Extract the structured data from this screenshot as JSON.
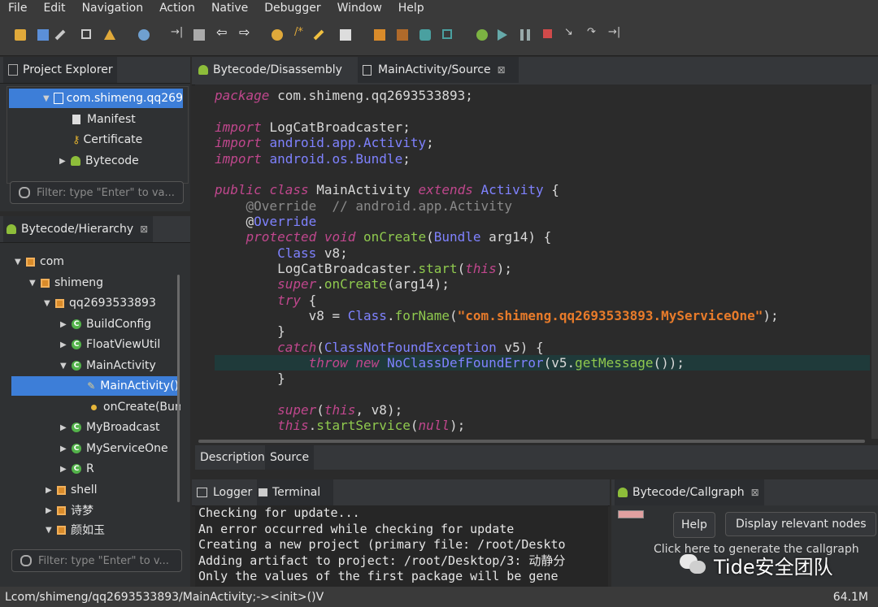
{
  "menu": [
    "File",
    "Edit",
    "Navigation",
    "Action",
    "Native",
    "Debugger",
    "Window",
    "Help"
  ],
  "project_explorer": {
    "tab": "Project Explorer",
    "items": [
      {
        "label": "com.shimeng.qq269",
        "kind": "project",
        "selected": true
      },
      {
        "label": "Manifest",
        "kind": "manifest"
      },
      {
        "label": "Certificate",
        "kind": "key"
      },
      {
        "label": "Bytecode",
        "kind": "droid"
      }
    ],
    "filter_placeholder": "Filter: type \"Enter\" to va..."
  },
  "hierarchy": {
    "tab": "Bytecode/Hierarchy",
    "items": [
      {
        "label": "com",
        "kind": "pkg",
        "expanded": true
      },
      {
        "label": "shimeng",
        "kind": "pkg",
        "expanded": true
      },
      {
        "label": "qq2693533893",
        "kind": "pkg",
        "expanded": true
      },
      {
        "label": "BuildConfig",
        "kind": "class"
      },
      {
        "label": "FloatViewUtil",
        "kind": "class"
      },
      {
        "label": "MainActivity",
        "kind": "class",
        "expanded": true
      },
      {
        "label": "MainActivity()",
        "kind": "method",
        "selected": true
      },
      {
        "label": "onCreate(Bun",
        "kind": "method"
      },
      {
        "label": "MyBroadcast",
        "kind": "class"
      },
      {
        "label": "MyServiceOne",
        "kind": "class"
      },
      {
        "label": "R",
        "kind": "class"
      },
      {
        "label": "shell",
        "kind": "pkg"
      },
      {
        "label": "诗梦",
        "kind": "pkg"
      },
      {
        "label": "颜如玉",
        "kind": "pkg",
        "expanded": true
      }
    ],
    "filter_placeholder": "Filter: type \"Enter\" to v..."
  },
  "editor": {
    "tabs": [
      "Bytecode/Disassembly",
      "MainActivity/Source"
    ],
    "bottom_tabs": [
      "Description",
      "Source"
    ]
  },
  "code_lines": [
    "package com.shimeng.qq2693533893;",
    "",
    "import LogCatBroadcaster;",
    "import android.app.Activity;",
    "import android.os.Bundle;",
    "",
    "public class MainActivity extends Activity {",
    "    @Override  // android.app.Activity",
    "    @Override",
    "    protected void onCreate(Bundle arg14) {",
    "        Class v8;",
    "        LogCatBroadcaster.start(this);",
    "        super.onCreate(arg14);",
    "        try {",
    "            v8 = Class.forName(\"com.shimeng.qq2693533893.MyServiceOne\");",
    "        }",
    "        catch(ClassNotFoundException v5) {",
    "            throw new NoClassDefFoundError(v5.getMessage());",
    "        }",
    "",
    "        super(this, v8);",
    "        this.startService(null);"
  ],
  "console": {
    "tabs": [
      "Logger",
      "Terminal"
    ],
    "lines": [
      "Checking for update...",
      "An error occurred while checking for update",
      "Creating a new project (primary file: /root/Deskto",
      "Adding artifact to project: /root/Desktop/3: 动静分",
      "Only the values of the first package will be gene"
    ]
  },
  "callgraph": {
    "tab": "Bytecode/Callgraph",
    "help_button": "Help",
    "relevant_button": "Display relevant nodes",
    "message": "Click here to generate the callgraph"
  },
  "watermark": "Tide安全团队",
  "status": {
    "path": "Lcom/shimeng/qq2693533893/MainActivity;-><init>()V",
    "memory": "64.1M"
  },
  "colors": {
    "selection": "#3d7ed8",
    "keyword": "#c0478d",
    "type": "#7f82ff",
    "method": "#8fc94e",
    "string": "#e87b2a"
  }
}
